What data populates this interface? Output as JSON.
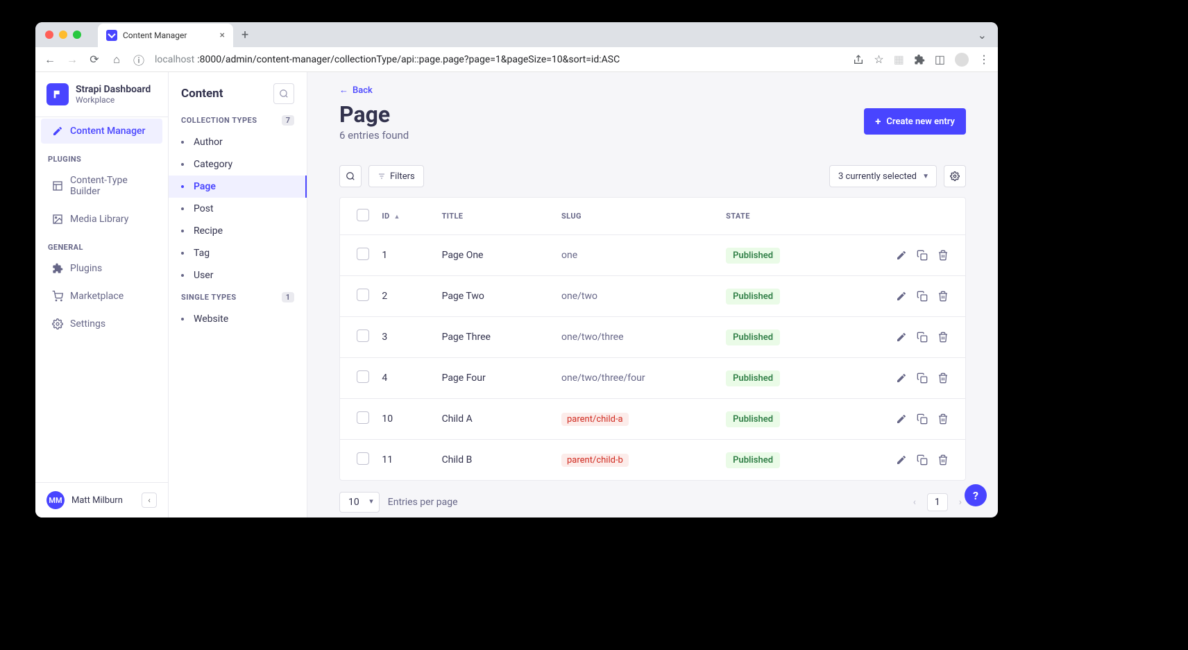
{
  "browser": {
    "tab_title": "Content Manager",
    "url_host_dim1": "localhost",
    "url_rest": ":8000/admin/content-manager/collectionType/api::page.page?page=1&pageSize=10&sort=id:ASC"
  },
  "sidebar": {
    "brand_title": "Strapi Dashboard",
    "brand_subtitle": "Workplace",
    "active_item": "Content Manager",
    "section_plugins": "PLUGINS",
    "plugins": [
      "Content-Type Builder",
      "Media Library"
    ],
    "section_general": "GENERAL",
    "general": [
      "Plugins",
      "Marketplace",
      "Settings"
    ],
    "user_initials": "MM",
    "user_name": "Matt Milburn"
  },
  "content_panel": {
    "title": "Content",
    "collection_label": "COLLECTION TYPES",
    "collection_count": "7",
    "collection_items": [
      "Author",
      "Category",
      "Page",
      "Post",
      "Recipe",
      "Tag",
      "User"
    ],
    "collection_active": "Page",
    "single_label": "SINGLE TYPES",
    "single_count": "1",
    "single_items": [
      "Website"
    ]
  },
  "main": {
    "back": "Back",
    "heading": "Page",
    "subheading": "6 entries found",
    "create_label": "Create new entry",
    "filters_label": "Filters",
    "selected_label": "3 currently selected",
    "columns": {
      "id": "ID",
      "title": "TITLE",
      "slug": "SLUG",
      "state": "STATE"
    },
    "rows": [
      {
        "id": "1",
        "title": "Page One",
        "slug": "one",
        "slug_hi": false,
        "state": "Published"
      },
      {
        "id": "2",
        "title": "Page Two",
        "slug": "one/two",
        "slug_hi": false,
        "state": "Published"
      },
      {
        "id": "3",
        "title": "Page Three",
        "slug": "one/two/three",
        "slug_hi": false,
        "state": "Published"
      },
      {
        "id": "4",
        "title": "Page Four",
        "slug": "one/two/three/four",
        "slug_hi": false,
        "state": "Published"
      },
      {
        "id": "10",
        "title": "Child A",
        "slug": "parent/child-a",
        "slug_hi": true,
        "state": "Published"
      },
      {
        "id": "11",
        "title": "Child B",
        "slug": "parent/child-b",
        "slug_hi": true,
        "state": "Published"
      }
    ],
    "page_size": "10",
    "epp_label": "Entries per page",
    "current_page": "1"
  },
  "help_label": "?"
}
